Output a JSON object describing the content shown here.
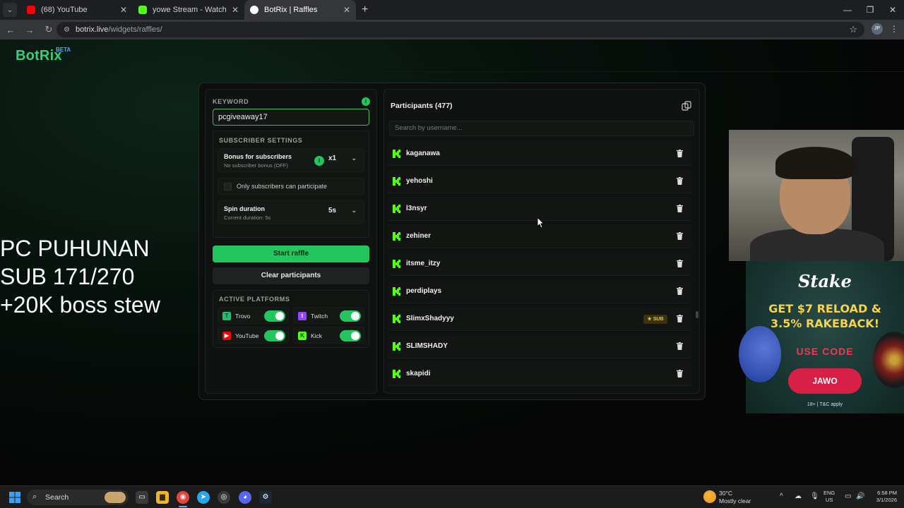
{
  "browser": {
    "tabs": [
      {
        "title": "(68) YouTube",
        "favicon_color": "#ff0000",
        "active": false
      },
      {
        "title": "yowe Stream - Watch Live on Ki",
        "favicon_color": "#53fc18",
        "active": false
      },
      {
        "title": "BotRix | Raffles",
        "favicon_color": "#ffffff",
        "active": true
      }
    ],
    "url": "botrix.live",
    "url_path": "/widgets/raffles/",
    "profile_initials": "JP"
  },
  "site": {
    "logo": "BotRix",
    "beta": "BETA"
  },
  "raffle": {
    "keyword_label": "KEYWORD",
    "keyword_value": "pcgiveaway17",
    "subscriber_settings_label": "SUBSCRIBER SETTINGS",
    "bonus_title": "Bonus for subscribers",
    "bonus_sub": "No subscriber bonus (OFF)",
    "bonus_multiplier": "x1",
    "only_subs_label": "Only subscribers can participate",
    "spin_title": "Spin duration",
    "spin_sub": "Current duration: 5s",
    "spin_value": "5s",
    "start_label": "Start raffle",
    "clear_label": "Clear participants",
    "active_platforms_label": "ACTIVE PLATFORMS",
    "platforms": [
      {
        "name": "Trovo",
        "enabled": true,
        "color": "#1ec06b"
      },
      {
        "name": "Twitch",
        "enabled": true,
        "color": "#9146ff"
      },
      {
        "name": "YouTube",
        "enabled": true,
        "color": "#ff0000"
      },
      {
        "name": "Kick",
        "enabled": true,
        "color": "#53fc18"
      }
    ]
  },
  "participants": {
    "title": "Participants (477)",
    "search_placeholder": "Search by username...",
    "sub_badge": "SUB",
    "items": [
      {
        "name": "kaganawa",
        "sub": false
      },
      {
        "name": "yehoshi",
        "sub": false
      },
      {
        "name": "l3nsyr",
        "sub": false
      },
      {
        "name": "zehiner",
        "sub": false
      },
      {
        "name": "itsme_itzy",
        "sub": false
      },
      {
        "name": "perdiplays",
        "sub": false
      },
      {
        "name": "SlimxShadyyy",
        "sub": true
      },
      {
        "name": "SLIMSHADY",
        "sub": false
      },
      {
        "name": "skapidi",
        "sub": false
      }
    ]
  },
  "overlay": {
    "line1": "PC PUHUNAN",
    "line2": "SUB 171/270",
    "line3": "+20K boss stew"
  },
  "ad": {
    "logo": "Stake",
    "line1": "GET $7 RELOAD &",
    "line2": "3.5% RAKEBACK!",
    "code_label": "USE CODE",
    "code": "JAWO",
    "tc": "18+ | T&C apply"
  },
  "taskbar": {
    "search_label": "Search",
    "weather_temp": "30°C",
    "weather_cond": "Mostly clear",
    "lang_top": "ENG",
    "lang_bottom": "US",
    "time": "6:58 PM",
    "date": "3/1/2026"
  }
}
